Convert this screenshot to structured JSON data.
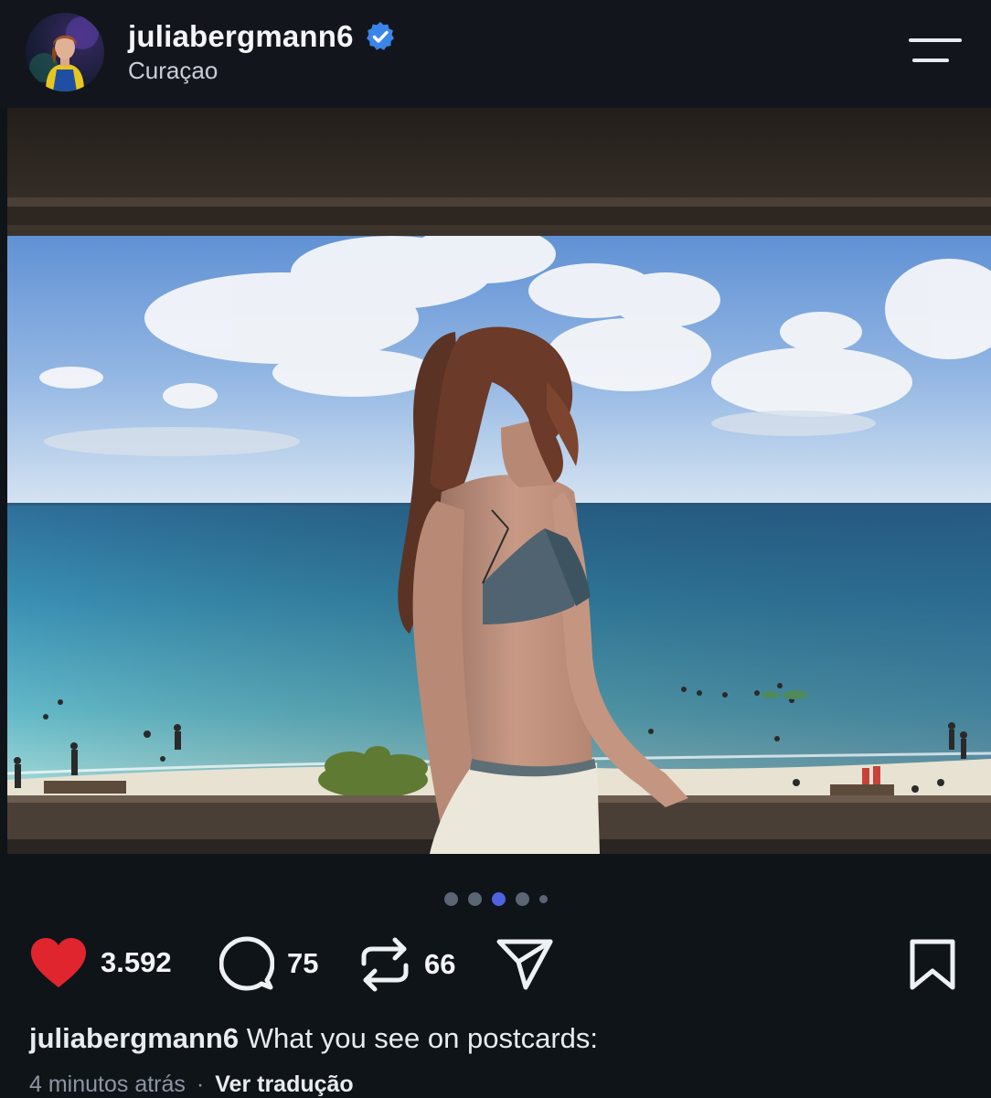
{
  "post": {
    "username": "juliabergmann6",
    "location": "Curaçao",
    "verified": true
  },
  "carousel": {
    "total_slides": 5,
    "active_index": 2
  },
  "actions": {
    "likes": "3.592",
    "comments": "75",
    "reposts": "66",
    "liked": true
  },
  "caption": {
    "username": "juliabergmann6",
    "text": "What you see on postcards:"
  },
  "meta": {
    "time": "4 minutos atrás",
    "separator": "·",
    "translate_label": "Ver tradução"
  },
  "icons": {
    "verified": "verified-badge-icon",
    "menu": "hamburger-menu-icon",
    "like": "heart-icon",
    "comment": "comment-bubble-icon",
    "repost": "repost-icon",
    "share": "send-icon",
    "save": "bookmark-icon"
  },
  "colors": {
    "background": "#0f1419",
    "verified": "#3a86e8",
    "like": "#e0252f",
    "active_dot": "#4f63e0"
  }
}
